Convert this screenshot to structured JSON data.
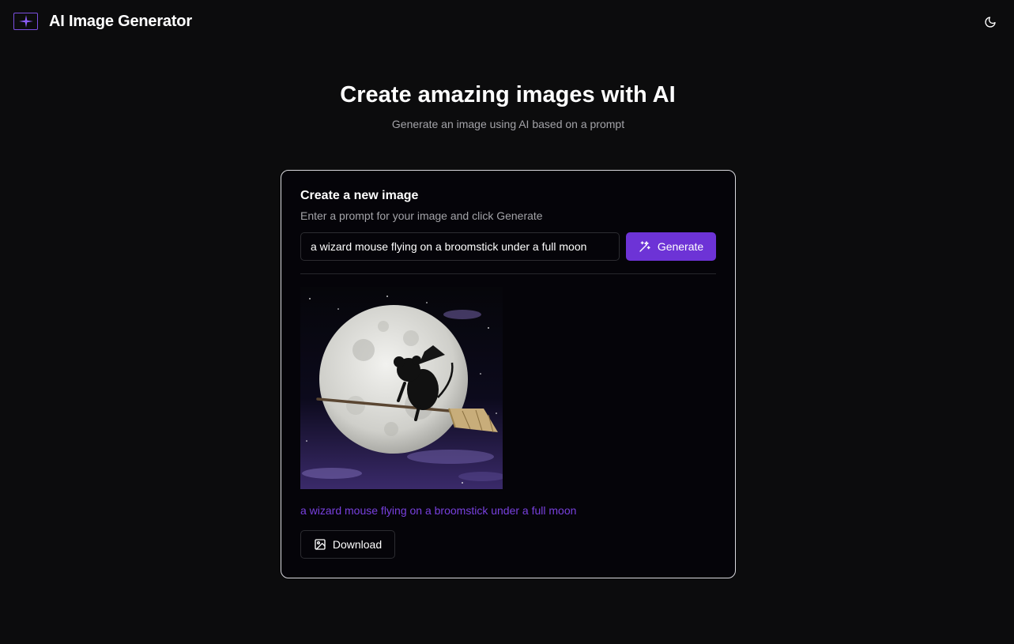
{
  "header": {
    "app_title": "AI Image Generator",
    "logo_icon": "sparkle-icon",
    "theme_icon": "moon-icon"
  },
  "hero": {
    "title": "Create amazing images with AI",
    "subtitle": "Generate an image using AI based on a prompt"
  },
  "card": {
    "title": "Create a new image",
    "description": "Enter a prompt for your image and click Generate",
    "prompt_value": "a wizard mouse flying on a broomstick under a full moon",
    "generate_label": "Generate",
    "generate_icon": "magic-wand-icon",
    "result": {
      "caption": "a wizard mouse flying on a broomstick under a full moon",
      "download_label": "Download",
      "download_icon": "image-download-icon"
    }
  },
  "colors": {
    "accent": "#6d33d6",
    "caption": "#7840de",
    "background": "#0c0c0d",
    "card_background": "#050409",
    "card_border": "#d9d9de",
    "muted_text": "#a3a3a8"
  }
}
